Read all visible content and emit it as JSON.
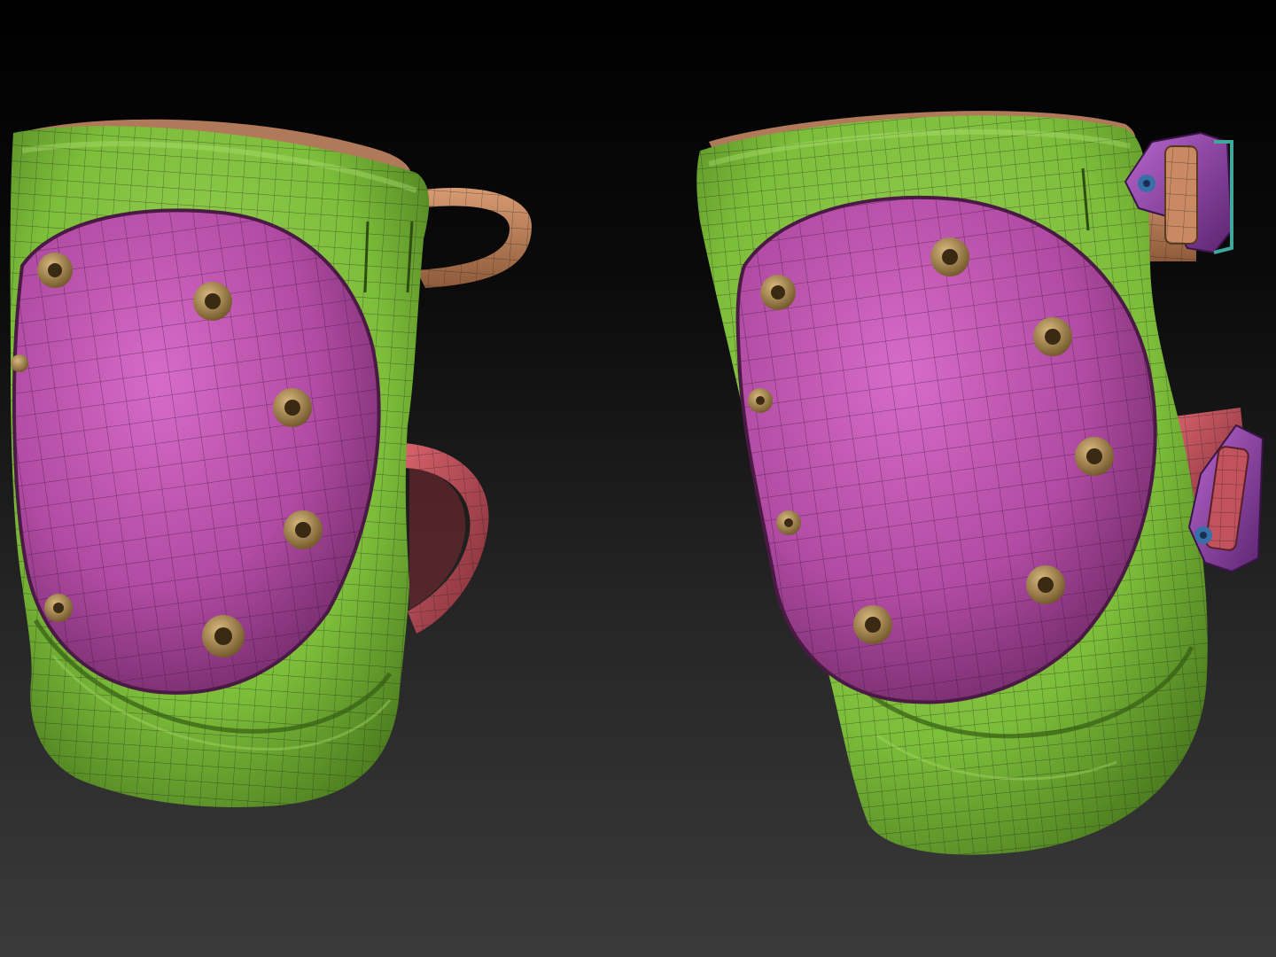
{
  "scene": {
    "background": {
      "top": "#000000",
      "bottom": "#3a3a3a"
    },
    "objects": [
      {
        "name": "knee-pad-left",
        "view": "front-three-quarter",
        "grommets": 7,
        "straps": 2
      },
      {
        "name": "knee-pad-right",
        "view": "front-side",
        "grommets": 8,
        "straps": 2,
        "buckles": 2
      }
    ],
    "materials": {
      "padding": "#7fbf3a",
      "padding_dark": "#4a7a1c",
      "shell": "#b64fa8",
      "shell_dark": "#6e2a66",
      "grommet": "#a68652",
      "strap_upper": "#c98a63",
      "strap_lower": "#c2525d",
      "buckle": "#9a48b0",
      "buckle_edge": "#3fa89a",
      "wire": "#1e1e1e"
    }
  }
}
